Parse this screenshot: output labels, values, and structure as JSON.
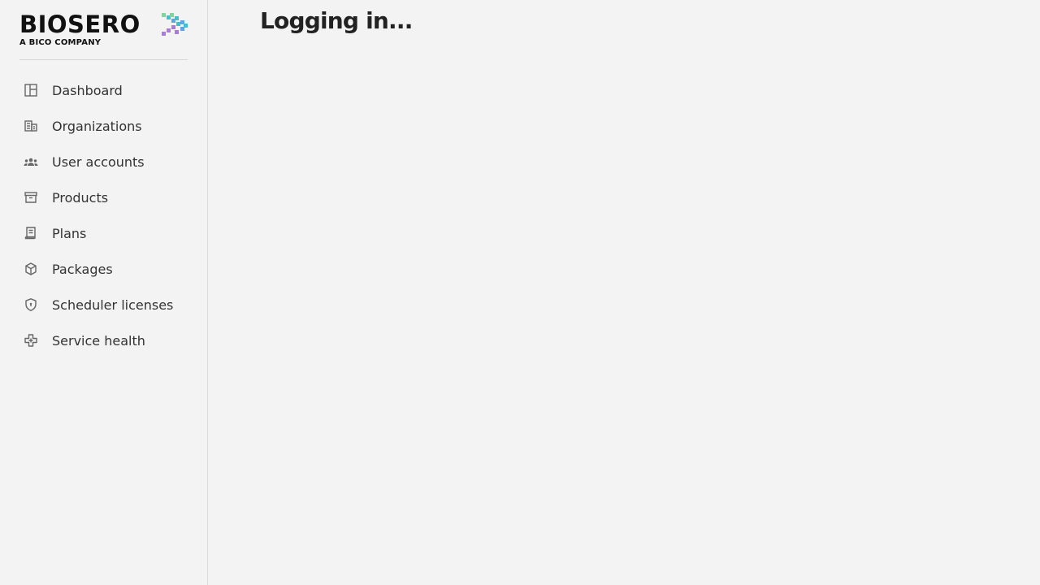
{
  "brand": {
    "name": "BIOSERO",
    "tagline": "A BICO COMPANY",
    "mark_colors": [
      "#a77be0",
      "#3cc3c9",
      "#7ad89a",
      "#5aa6e8"
    ]
  },
  "sidebar": {
    "items": [
      {
        "label": "Dashboard",
        "icon": "dashboard-icon"
      },
      {
        "label": "Organizations",
        "icon": "building-icon"
      },
      {
        "label": "User accounts",
        "icon": "users-icon"
      },
      {
        "label": "Products",
        "icon": "archive-box-icon"
      },
      {
        "label": "Plans",
        "icon": "receipt-icon"
      },
      {
        "label": "Packages",
        "icon": "cube-icon"
      },
      {
        "label": "Scheduler licenses",
        "icon": "shield-icon"
      },
      {
        "label": "Service health",
        "icon": "puzzle-icon"
      }
    ]
  },
  "main": {
    "title": "Logging in..."
  },
  "colors": {
    "background": "#f3f3f3",
    "icon": "#666666",
    "text": "#333333"
  }
}
